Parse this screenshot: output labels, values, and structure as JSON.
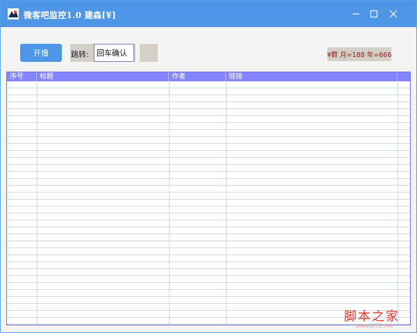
{
  "window": {
    "title": "微客吧监控1.0 建森[¥]",
    "app_icon": "app-logo-icon",
    "controls": [
      "minimize-icon",
      "maximize-icon",
      "close-icon"
    ]
  },
  "toolbar": {
    "start_label": "开撸",
    "jump_label": "跳转:",
    "jump_input_value": "回车确认",
    "stats": "¥群 月=188 年=666"
  },
  "table": {
    "columns": [
      "序号",
      "标题",
      "作者",
      "链接"
    ],
    "row_count": 35
  },
  "watermark": {
    "text": "脚本之家",
    "url": "www.jb51.net"
  },
  "colors": {
    "titlebar": "#4d95e6",
    "header": "#8484ff",
    "stats_text": "#8b1a1a"
  }
}
